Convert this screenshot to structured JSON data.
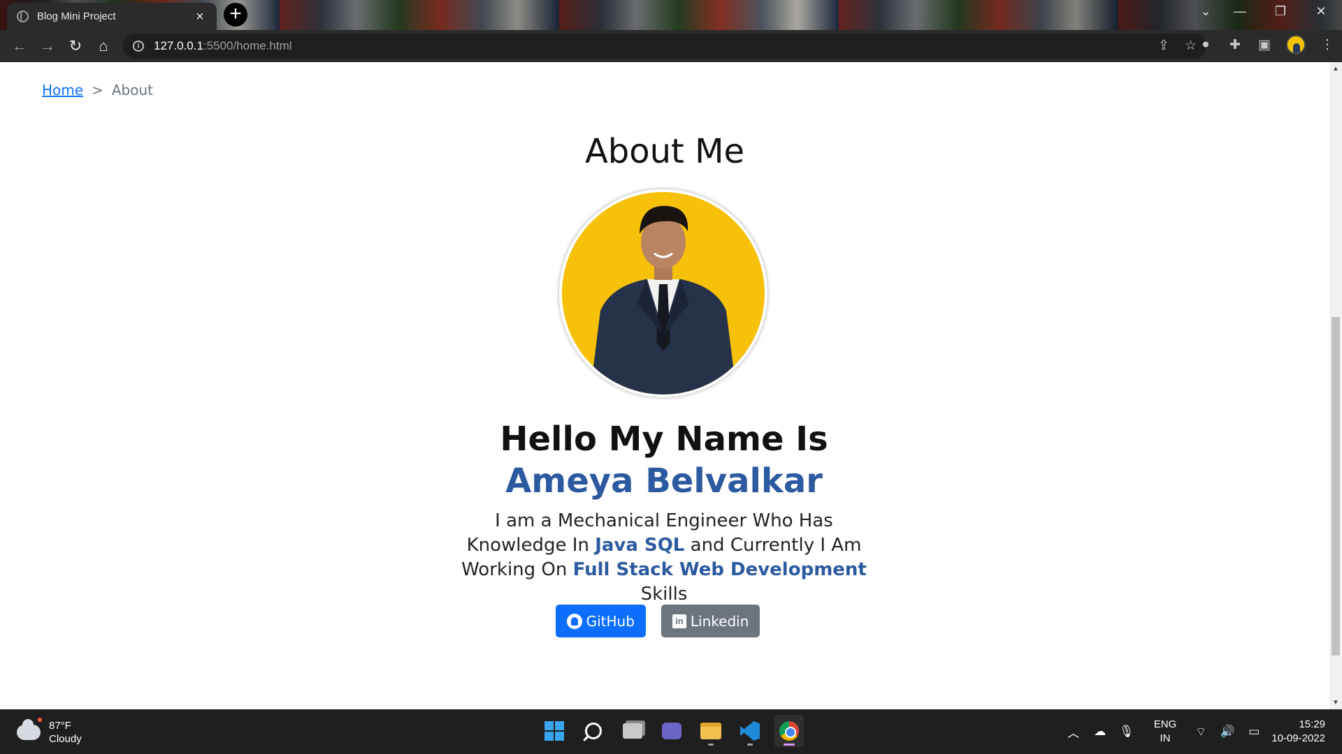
{
  "browser": {
    "tab_title": "Blog Mini Project",
    "tab_close": "×",
    "new_tab": "+",
    "url_host": "127.0.0.1",
    "url_path": ":5500/home.html",
    "window_controls": [
      "—",
      "❐",
      "✕"
    ],
    "nav_icons": [
      "back-icon",
      "forward-icon",
      "reload-icon",
      "home-icon"
    ],
    "toolbar_icons": [
      "share-icon",
      "star-icon",
      "extension-puzzle-icon",
      "sidebar-icon",
      "profile-avatar",
      "menu-dots-icon"
    ]
  },
  "breadcrumb": {
    "home": "Home",
    "separator": ">",
    "current": "About"
  },
  "about": {
    "title": "About Me",
    "hello_prefix": "Hello My Name Is",
    "name": "Ameya Belvalkar",
    "bio_1": "I am a Mechanical Engineer Who Has Knowledge In",
    "bio_skill_1": "Java SQL",
    "bio_2": "and Currently I Am Working On",
    "bio_skill_2": "Full Stack Web Development",
    "bio_3": "Skills",
    "accent_color": "#2c5aa0"
  },
  "buttons": {
    "github": "GitHub",
    "linkedin": "Linkedin",
    "github_color": "#0d6efd",
    "linkedin_color": "#6c757d"
  },
  "taskbar": {
    "temperature": "87°F",
    "weather": "Cloudy",
    "lang_1": "ENG",
    "lang_2": "IN",
    "time": "15:29",
    "date": "10-09-2022",
    "apps": [
      "start-icon",
      "search-icon",
      "task-view-icon",
      "teams-chat-icon",
      "file-explorer-icon",
      "vscode-icon",
      "chrome-icon"
    ]
  }
}
